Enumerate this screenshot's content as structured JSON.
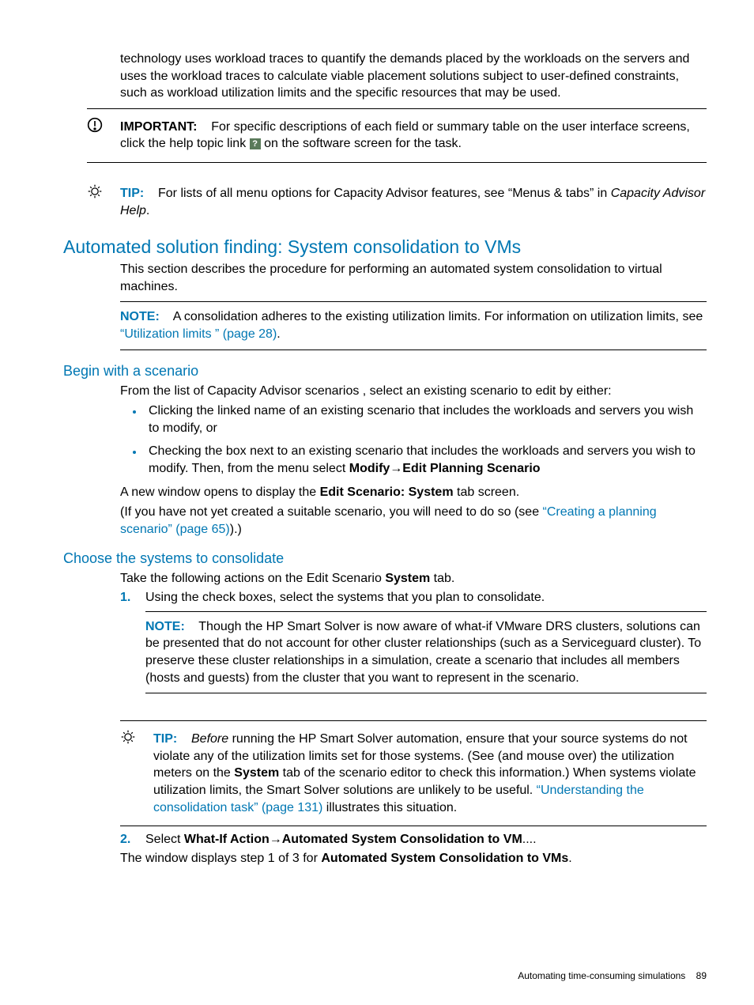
{
  "intro": {
    "p1": "technology uses workload traces to quantify the demands placed by the workloads on the servers and uses the workload traces to calculate viable placement solutions subject to user-defined constraints, such as workload utilization limits and the specific resources that may be used."
  },
  "important": {
    "label": "IMPORTANT:",
    "text_before": "For specific descriptions of each field or summary table on the user interface screens, click the help topic link ",
    "text_after": " on the software screen for the task.",
    "help_glyph": "?"
  },
  "tip1": {
    "label": "TIP:",
    "text_before": "For lists of all menu options for Capacity Advisor features, see “Menus & tabs” in ",
    "italic": "Capacity Advisor Help",
    "text_after": "."
  },
  "h2": "Automated solution finding: System consolidation to VMs",
  "section_intro": "This section describes the procedure for performing an automated system consolidation to virtual machines.",
  "note1": {
    "label": "NOTE:",
    "text_before": "A consolidation adheres to the existing utilization limits. For information on utilization limits, see ",
    "link": "“Utilization limits ” (page 28)",
    "text_after": "."
  },
  "h3a": "Begin with a scenario",
  "begin": {
    "p1": "From the list of Capacity Advisor scenarios , select an existing scenario to edit by either:",
    "li1": "Clicking the linked name of an existing scenario that includes the workloads and servers you wish to modify, or",
    "li2_before": "Checking the box next to an existing scenario that includes the workloads and servers you wish to modify. Then, from the menu select ",
    "li2_bold_a": "Modify",
    "li2_arrow": "→",
    "li2_bold_b": "Edit Planning Scenario",
    "p2_before": "A new window opens to display the ",
    "p2_bold": "Edit Scenario: System",
    "p2_after": " tab screen.",
    "p3_before": "(If you have not yet created a suitable scenario, you will need to do so (see ",
    "p3_link": "“Creating a planning scenario” (page 65)",
    "p3_after": ").)"
  },
  "h3b": "Choose the systems to consolidate",
  "choose": {
    "p1_before": "Take the following actions on the Edit Scenario ",
    "p1_bold": "System",
    "p1_after": " tab.",
    "step1_num": "1.",
    "step1": "Using the check boxes, select the systems that you plan to consolidate.",
    "note2": {
      "label": "NOTE:",
      "text": "Though the HP Smart Solver is now aware of what-if VMware DRS clusters, solutions can be presented that do not account for other cluster relationships (such as a Serviceguard cluster). To preserve these cluster relationships in a simulation, create a scenario that includes all members (hosts and guests) from the cluster that you want to represent in the scenario."
    },
    "tip2": {
      "label": "TIP:",
      "italic": "Before",
      "text_mid": " running the HP Smart Solver automation, ensure that your source systems do not violate any of the utilization limits set for those systems. (See (and mouse over) the utilization meters on the ",
      "bold": "System",
      "text_mid2": " tab of the scenario editor to check this information.) When systems violate utilization limits, the Smart Solver solutions are unlikely to be useful. ",
      "link": "“Understanding the consolidation task” (page 131)",
      "text_after": " illustrates this situation."
    },
    "step2_num": "2.",
    "step2_before": "Select ",
    "step2_bold_a": "What-If Action",
    "step2_arrow": "→",
    "step2_bold_b": "Automated System Consolidation to VM",
    "step2_after": "....",
    "p_final_before": "The window displays step 1 of 3 for ",
    "p_final_bold": "Automated System Consolidation to VMs",
    "p_final_after": "."
  },
  "footer": {
    "text": "Automating time-consuming simulations",
    "page": "89"
  }
}
